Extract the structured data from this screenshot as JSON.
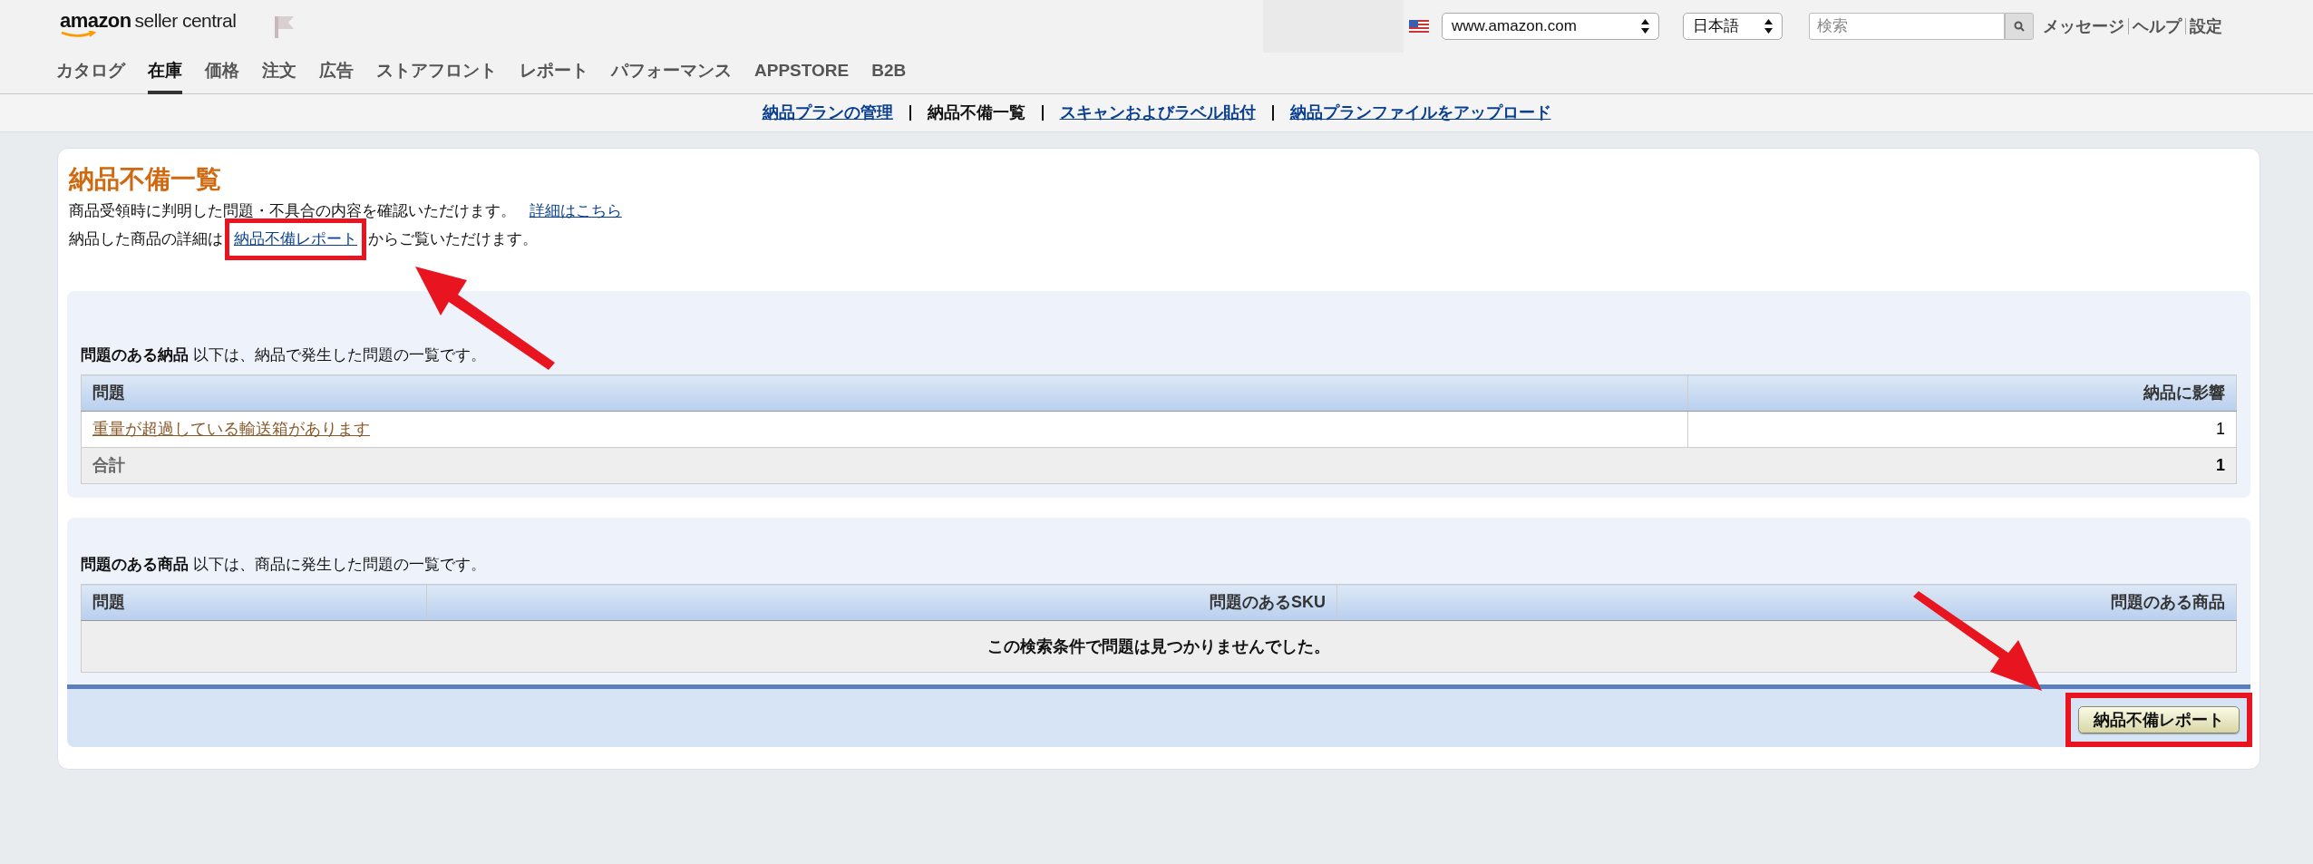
{
  "header": {
    "logo": {
      "brand": "amazon",
      "product": "seller central"
    },
    "marketplace": "www.amazon.com",
    "language": "日本語",
    "search": {
      "placeholder": "検索"
    },
    "links": [
      "メッセージ",
      "ヘルプ",
      "設定"
    ]
  },
  "nav": [
    {
      "label": "カタログ",
      "selected": false
    },
    {
      "label": "在庫",
      "selected": true
    },
    {
      "label": "価格",
      "selected": false
    },
    {
      "label": "注文",
      "selected": false
    },
    {
      "label": "広告",
      "selected": false
    },
    {
      "label": "ストアフロント",
      "selected": false
    },
    {
      "label": "レポート",
      "selected": false
    },
    {
      "label": "パフォーマンス",
      "selected": false
    },
    {
      "label": "APPSTORE",
      "selected": false
    },
    {
      "label": "B2B",
      "selected": false
    }
  ],
  "subnav": [
    {
      "label": "納品プランの管理",
      "selected": false
    },
    {
      "label": "納品不備一覧",
      "selected": true
    },
    {
      "label": "スキャンおよびラベル貼付",
      "selected": false
    },
    {
      "label": "納品プランファイルをアップロード",
      "selected": false
    }
  ],
  "page": {
    "title": "納品不備一覧",
    "intro": {
      "text": "商品受領時に判明した問題・不具合の内容を確認いただけます。",
      "link": "詳細はこちら"
    },
    "report_line": {
      "before": "納品した商品の詳細は",
      "link": "納品不備レポート",
      "after": "からご覧いただけます。"
    }
  },
  "shipment_issues": {
    "heading": "問題のある納品",
    "description": "以下は、納品で発生した問題の一覧です。",
    "columns": [
      "問題",
      "納品に影響"
    ],
    "rows": [
      {
        "issue": "重量が超過している輸送箱があります",
        "count": "1"
      }
    ],
    "total": {
      "label": "合計",
      "value": "1"
    }
  },
  "product_issues": {
    "heading": "問題のある商品",
    "description": "以下は、商品に発生した問題の一覧です。",
    "columns": [
      "問題",
      "問題のあるSKU",
      "問題のある商品"
    ],
    "empty_message": "この検索条件で問題は見つかりませんでした。"
  },
  "footer_button": "納品不備レポート"
}
